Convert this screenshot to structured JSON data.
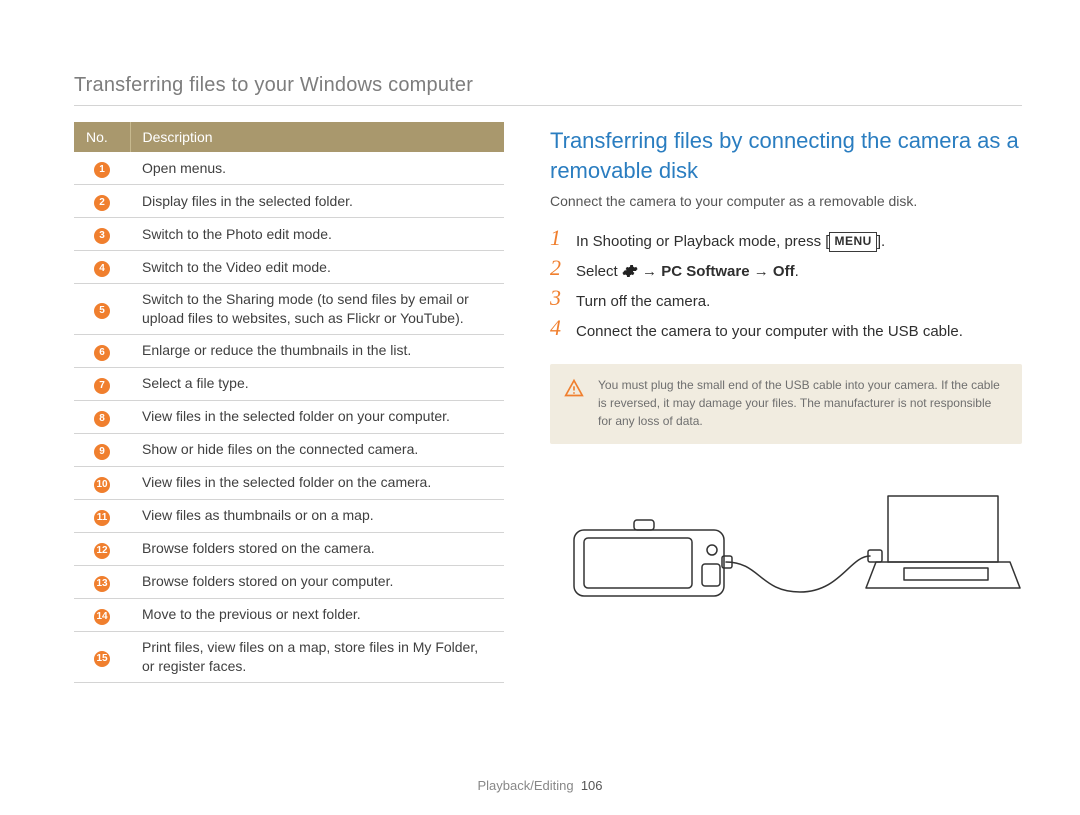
{
  "page_title": "Transferring files to your Windows computer",
  "table": {
    "headers": {
      "no": "No.",
      "desc": "Description"
    },
    "rows": [
      {
        "n": "1",
        "d": "Open menus."
      },
      {
        "n": "2",
        "d": "Display files in the selected folder."
      },
      {
        "n": "3",
        "d": "Switch to the Photo edit mode."
      },
      {
        "n": "4",
        "d": "Switch to the Video edit mode."
      },
      {
        "n": "5",
        "d": "Switch to the Sharing mode (to send files by email or upload files to websites, such as Flickr or YouTube)."
      },
      {
        "n": "6",
        "d": "Enlarge or reduce the thumbnails in the list."
      },
      {
        "n": "7",
        "d": "Select a file type."
      },
      {
        "n": "8",
        "d": "View files in the selected folder on your computer."
      },
      {
        "n": "9",
        "d": "Show or hide files on the connected camera."
      },
      {
        "n": "10",
        "d": "View files in the selected folder on the camera."
      },
      {
        "n": "11",
        "d": "View files as thumbnails or on a map."
      },
      {
        "n": "12",
        "d": "Browse folders stored on the camera."
      },
      {
        "n": "13",
        "d": "Browse folders stored on your computer."
      },
      {
        "n": "14",
        "d": "Move to the previous or next folder."
      },
      {
        "n": "15",
        "d": "Print files, view files on a map, store files in My Folder, or register faces."
      }
    ]
  },
  "section_heading": "Transferring files by connecting the camera as a removable disk",
  "section_lead": "Connect the camera to your computer as a removable disk.",
  "steps": {
    "s1_pre": "In Shooting or Playback mode, press [",
    "s1_menu": "MENU",
    "s1_post": "].",
    "s2_pre": "Select ",
    "s2_arrow1": " → ",
    "s2_pc": "PC Software",
    "s2_arrow2": " → ",
    "s2_off": "Off",
    "s2_post": ".",
    "s3": "Turn off the camera.",
    "s4": "Connect the camera to your computer with the USB cable."
  },
  "note": "You must plug the small end of the USB cable into your camera. If the cable is reversed, it may damage your files. The manufacturer is not responsible for any loss of data.",
  "footer": {
    "section": "Playback/Editing",
    "page": "106"
  }
}
